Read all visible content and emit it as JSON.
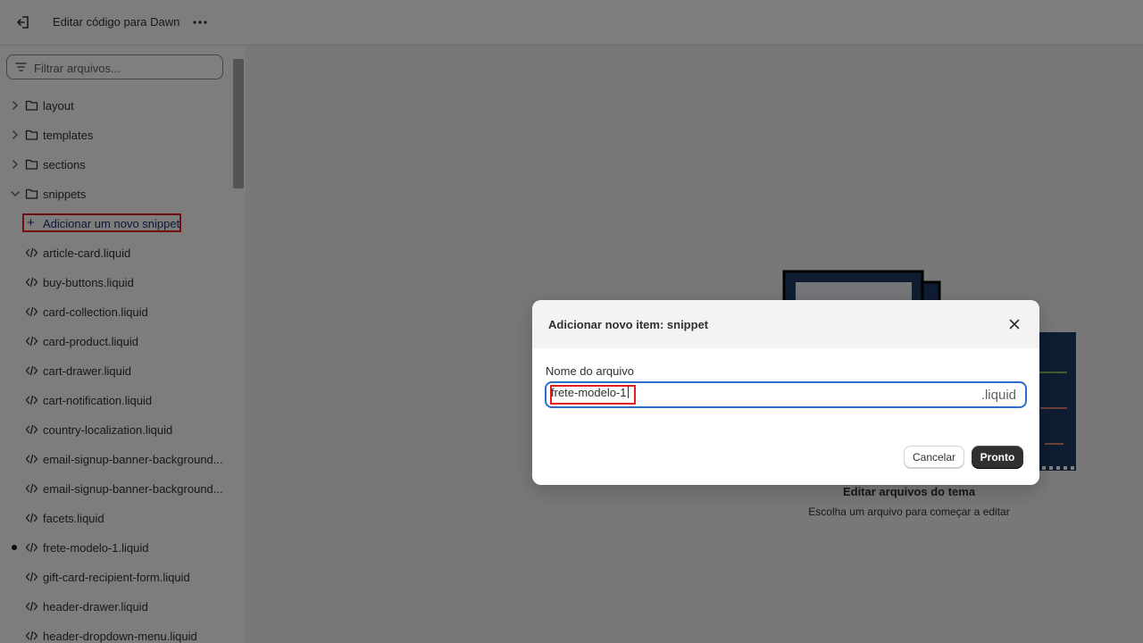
{
  "topbar": {
    "title": "Editar código para Dawn",
    "exit_icon": "exit-icon",
    "more_icon": "more-horizontal-icon"
  },
  "sidebar": {
    "search_placeholder": "Filtrar arquivos...",
    "folders": [
      {
        "label": "layout",
        "expanded": false
      },
      {
        "label": "templates",
        "expanded": false
      },
      {
        "label": "sections",
        "expanded": false
      },
      {
        "label": "snippets",
        "expanded": true
      }
    ],
    "add_snippet_label": "Adicionar um novo snippet",
    "files": [
      {
        "label": "article-card.liquid"
      },
      {
        "label": "buy-buttons.liquid"
      },
      {
        "label": "card-collection.liquid"
      },
      {
        "label": "card-product.liquid"
      },
      {
        "label": "cart-drawer.liquid"
      },
      {
        "label": "cart-notification.liquid"
      },
      {
        "label": "country-localization.liquid"
      },
      {
        "label": "email-signup-banner-background..."
      },
      {
        "label": "email-signup-banner-background..."
      },
      {
        "label": "facets.liquid"
      },
      {
        "label": "frete-modelo-1.liquid",
        "unsaved": true
      },
      {
        "label": "gift-card-recipient-form.liquid"
      },
      {
        "label": "header-drawer.liquid"
      },
      {
        "label": "header-dropdown-menu.liquid"
      }
    ]
  },
  "main": {
    "empty_title": "Editar arquivos do tema",
    "empty_subtitle": "Escolha um arquivo para começar a editar"
  },
  "modal": {
    "title": "Adicionar novo item: snippet",
    "field_label": "Nome do arquivo",
    "field_value": "frete-modelo-1",
    "field_suffix": ".liquid",
    "cancel_label": "Cancelar",
    "done_label": "Pronto"
  },
  "colors": {
    "accent": "#2c6ecb",
    "highlight": "#e41d1d",
    "primary_button": "#303030"
  }
}
